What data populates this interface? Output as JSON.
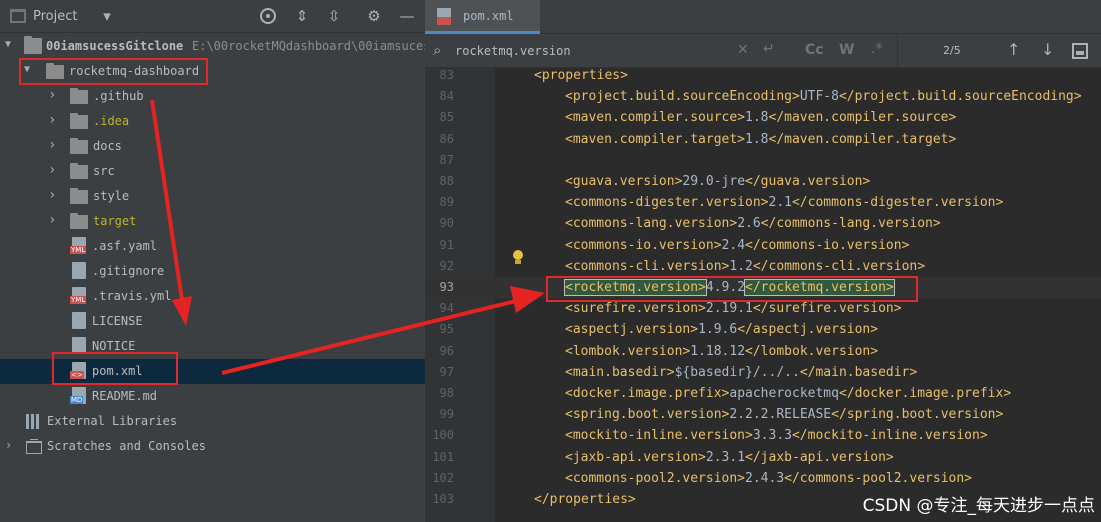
{
  "project_panel": {
    "title": "Project",
    "root": {
      "name": "00iamsucessGitclone",
      "path": "E:\\00rocketMQdashboard\\00iamsuces"
    },
    "items": [
      {
        "label": "rocketmq-dashboard",
        "kind": "folder",
        "expanded": true,
        "color": "#bbbbbb"
      },
      {
        "label": ".github",
        "kind": "folder",
        "color": "#bbbbbb"
      },
      {
        "label": ".idea",
        "kind": "folder",
        "color": "#bbb529"
      },
      {
        "label": "docs",
        "kind": "folder",
        "color": "#bbbbbb"
      },
      {
        "label": "src",
        "kind": "folder",
        "color": "#bbbbbb"
      },
      {
        "label": "style",
        "kind": "folder",
        "color": "#bbbbbb"
      },
      {
        "label": "target",
        "kind": "folder",
        "color": "#bbb529"
      },
      {
        "label": ".asf.yaml",
        "kind": "yml",
        "color": "#bbbbbb"
      },
      {
        "label": ".gitignore",
        "kind": "file",
        "color": "#bbbbbb"
      },
      {
        "label": ".travis.yml",
        "kind": "yml",
        "color": "#bbbbbb"
      },
      {
        "label": "LICENSE",
        "kind": "text",
        "color": "#bbbbbb"
      },
      {
        "label": "NOTICE",
        "kind": "text",
        "color": "#bbbbbb"
      },
      {
        "label": "pom.xml",
        "kind": "xml",
        "color": "#bbbbbb",
        "selected": true
      },
      {
        "label": "README.md",
        "kind": "md",
        "color": "#bbbbbb"
      }
    ],
    "external_libraries": "External Libraries",
    "scratches": "Scratches and Consoles"
  },
  "editor": {
    "tab_label": "pom.xml",
    "search": {
      "query": "rocketmq.version",
      "count": "2/5",
      "cc": "Cc",
      "w": "W"
    },
    "lines": [
      {
        "n": "83",
        "code": "<properties>",
        "indent": 0
      },
      {
        "n": "84",
        "code": "<project.build.sourceEncoding>UTF-8</project.build.sourceEncoding>",
        "indent": 1
      },
      {
        "n": "85",
        "code": "<maven.compiler.source>1.8</maven.compiler.source>",
        "indent": 1
      },
      {
        "n": "86",
        "code": "<maven.compiler.target>1.8</maven.compiler.target>",
        "indent": 1
      },
      {
        "n": "87",
        "code": "",
        "indent": 1
      },
      {
        "n": "88",
        "code": "<guava.version>29.0-jre</guava.version>",
        "indent": 1
      },
      {
        "n": "89",
        "code": "<commons-digester.version>2.1</commons-digester.version>",
        "indent": 1
      },
      {
        "n": "90",
        "code": "<commons-lang.version>2.6</commons-lang.version>",
        "indent": 1
      },
      {
        "n": "91",
        "code": "<commons-io.version>2.4</commons-io.version>",
        "indent": 1
      },
      {
        "n": "92",
        "code": "<commons-cli.version>1.2</commons-cli.version>",
        "indent": 1
      },
      {
        "n": "93",
        "code": "<rocketmq.version>4.9.2</rocketmq.version>",
        "indent": 1
      },
      {
        "n": "94",
        "code": "<surefire.version>2.19.1</surefire.version>",
        "indent": 1
      },
      {
        "n": "95",
        "code": "<aspectj.version>1.9.6</aspectj.version>",
        "indent": 1
      },
      {
        "n": "96",
        "code": "<lombok.version>1.18.12</lombok.version>",
        "indent": 1
      },
      {
        "n": "97",
        "code": "<main.basedir>${basedir}/../..</main.basedir>",
        "indent": 1
      },
      {
        "n": "98",
        "code": "<docker.image.prefix>apacherocketmq</docker.image.prefix>",
        "indent": 1
      },
      {
        "n": "99",
        "code": "<spring.boot.version>2.2.2.RELEASE</spring.boot.version>",
        "indent": 1
      },
      {
        "n": "100",
        "code": "<mockito-inline.version>3.3.3</mockito-inline.version>",
        "indent": 1
      },
      {
        "n": "101",
        "code": "<jaxb-api.version>2.3.1</jaxb-api.version>",
        "indent": 1
      },
      {
        "n": "102",
        "code": "<commons-pool2.version>2.4.3</commons-pool2.version>",
        "indent": 1
      },
      {
        "n": "103",
        "code": "</properties>",
        "indent": 0
      }
    ]
  },
  "watermark": "CSDN @专注_每天进步一点点"
}
